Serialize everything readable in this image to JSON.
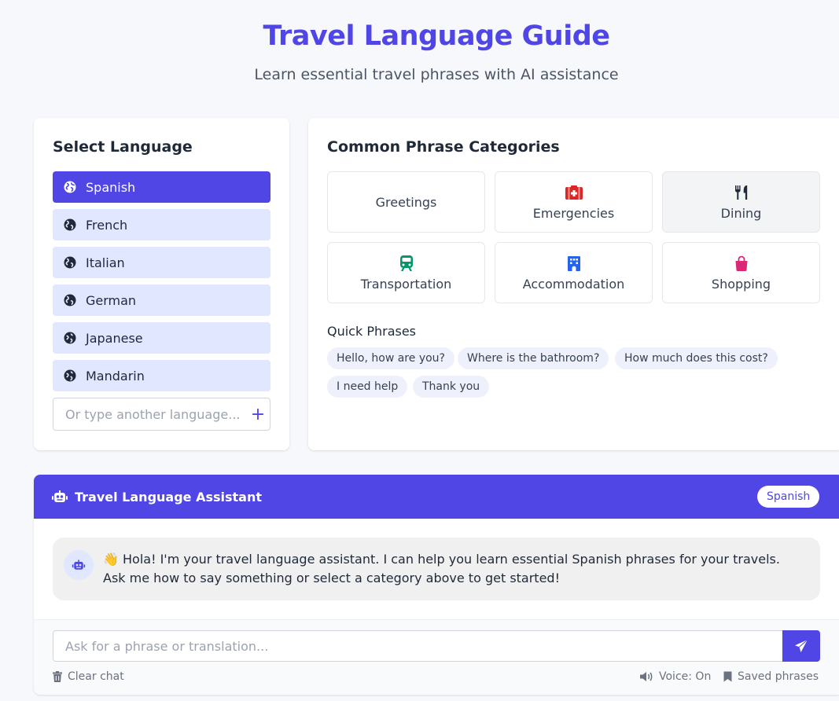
{
  "header": {
    "title": "Travel Language Guide",
    "subtitle": "Learn essential travel phrases with AI assistance"
  },
  "language_panel": {
    "title": "Select Language",
    "selected": "Spanish",
    "languages": [
      {
        "label": "Spanish",
        "icon": "globe-icon"
      },
      {
        "label": "French",
        "icon": "globe-icon"
      },
      {
        "label": "Italian",
        "icon": "globe-icon"
      },
      {
        "label": "German",
        "icon": "globe-icon"
      },
      {
        "label": "Japanese",
        "icon": "globe-icon"
      },
      {
        "label": "Mandarin",
        "icon": "globe-icon"
      }
    ],
    "custom_placeholder": "Or type another language...",
    "add_icon": "plus-icon"
  },
  "categories_panel": {
    "title": "Common Phrase Categories",
    "categories": [
      {
        "label": "Greetings",
        "icon": "none"
      },
      {
        "label": "Emergencies",
        "icon": "first-aid-icon",
        "color": "#dc2626"
      },
      {
        "label": "Dining",
        "icon": "utensils-icon",
        "color": "#1f2937"
      },
      {
        "label": "Transportation",
        "icon": "train-icon",
        "color": "#059669"
      },
      {
        "label": "Accommodation",
        "icon": "hotel-icon",
        "color": "#2563eb"
      },
      {
        "label": "Shopping",
        "icon": "shopping-bag-icon",
        "color": "#db2777"
      }
    ],
    "quick_title": "Quick Phrases",
    "quick_phrases": [
      "Hello, how are you?",
      "Where is the bathroom?",
      "How much does this cost?",
      "I need help",
      "Thank you"
    ]
  },
  "chat": {
    "title": "Travel Language Assistant",
    "language_badge": "Spanish",
    "messages": [
      {
        "sender": "assistant",
        "emoji": "👋",
        "text": "Hola! I'm your travel language assistant. I can help you learn essential Spanish phrases for your travels. Ask me how to say something or select a category above to get started!"
      }
    ],
    "input_placeholder": "Ask for a phrase or translation...",
    "clear_label": "Clear chat",
    "voice_label": "Voice: On",
    "saved_label": "Saved phrases"
  },
  "colors": {
    "accent": "#4f46e5",
    "accent_light": "#e0e7ff",
    "background": "#f7f8fb"
  }
}
